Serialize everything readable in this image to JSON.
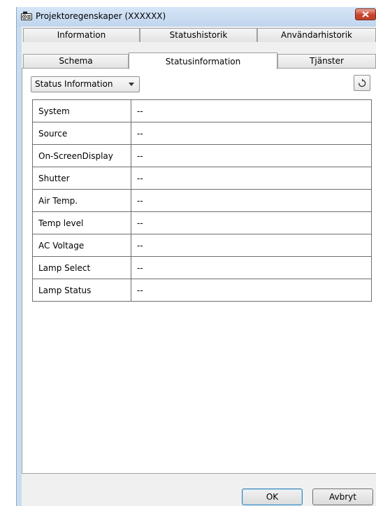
{
  "window": {
    "title": "Projektoregenskaper (XXXXXX)"
  },
  "tabs_back": [
    "Information",
    "Statushistorik",
    "Användarhistorik"
  ],
  "tabs_front": [
    "Schema",
    "Statusinformation",
    "Tjänster"
  ],
  "active_tab": "Statusinformation",
  "view_select": {
    "value": "Status Information"
  },
  "status_rows": [
    {
      "label": "System",
      "value": "--"
    },
    {
      "label": "Source",
      "value": "--"
    },
    {
      "label": "On-ScreenDisplay",
      "value": "--"
    },
    {
      "label": "Shutter",
      "value": "--"
    },
    {
      "label": "Air Temp.",
      "value": "--"
    },
    {
      "label": "Temp level",
      "value": "--"
    },
    {
      "label": "AC Voltage",
      "value": "--"
    },
    {
      "label": "Lamp Select",
      "value": "--"
    },
    {
      "label": "Lamp Status",
      "value": "--"
    }
  ],
  "buttons": {
    "ok": "OK",
    "cancel": "Avbryt"
  },
  "icons": {
    "app": "projector-icon",
    "close": "close-icon",
    "refresh": "refresh-icon",
    "dropdown": "chevron-down-icon"
  }
}
